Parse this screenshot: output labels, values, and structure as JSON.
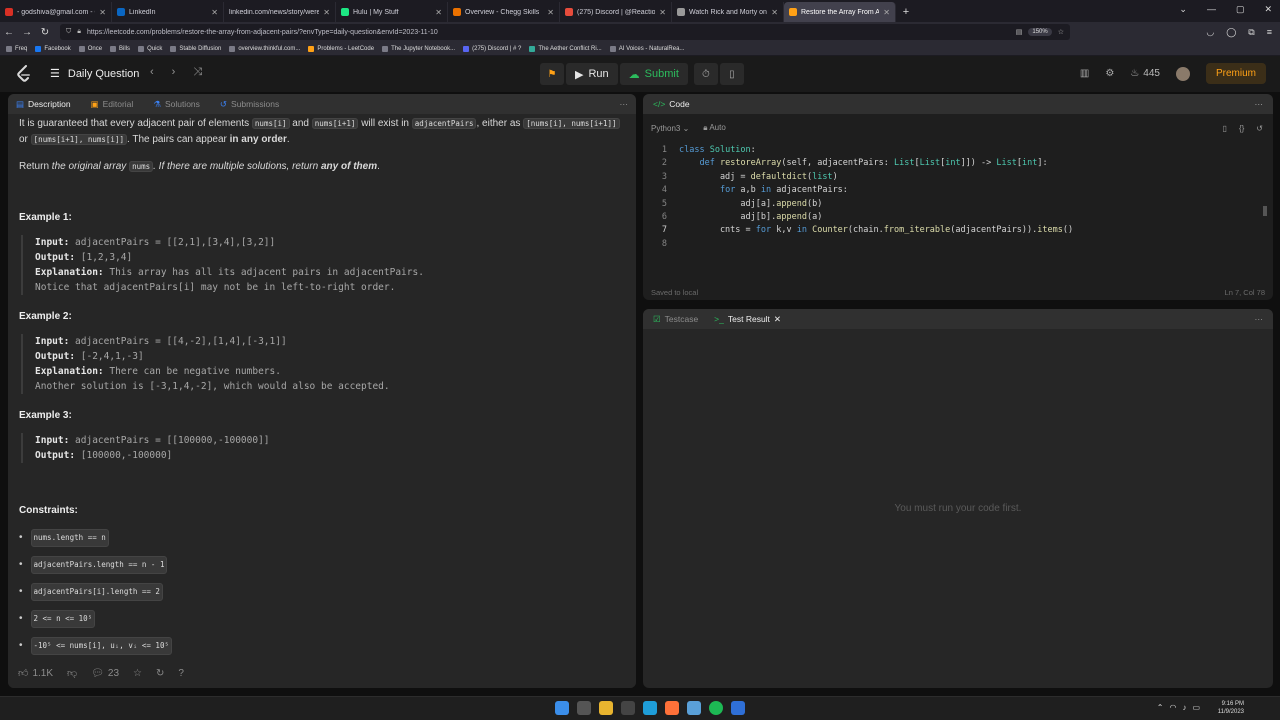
{
  "browser": {
    "tabs": [
      {
        "label": "- godshiva@gmail.com - Gmail",
        "color": "#d93025"
      },
      {
        "label": "LinkedIn",
        "color": "#0a66c2"
      },
      {
        "label": "linkedin.com/news/story/were-tipp",
        "color": "#777777"
      },
      {
        "label": "Hulu | My Stuff",
        "color": "#1ce783"
      },
      {
        "label": "Overview - Chegg Skills",
        "color": "#eb7100"
      },
      {
        "label": "(275) Discord | @Reaction Roles",
        "color": "#e74c3c"
      },
      {
        "label": "Watch Rick and Morty on Adult",
        "color": "#999999"
      },
      {
        "label": "Restore the Array From Adjacen",
        "color": "#ffa116",
        "active": true
      }
    ],
    "url": "https://leetcode.com/problems/restore-the-array-from-adjacent-pairs/?envType=daily-question&envId=2023-11-10",
    "zoom": "150%",
    "bookmarks": [
      "Freq",
      "Facebook",
      "Once",
      "Bills",
      "Quick",
      "Stable Diffusion",
      "overview.thinkful.com...",
      "Problems - LeetCode",
      "The Jupyter Notebook...",
      "(275) Discord | # ?",
      "The Aether Conflict Ri...",
      "AI Voices - NaturalRea..."
    ]
  },
  "header": {
    "daily_question": "Daily Question",
    "run": "Run",
    "submit": "Submit",
    "streak": "445",
    "premium": "Premium"
  },
  "left": {
    "tabs": [
      "Description",
      "Editorial",
      "Solutions",
      "Submissions"
    ],
    "para1": {
      "t1": "It is guaranteed that every adjacent pair of elements ",
      "c1": "nums[i]",
      "t2": " and ",
      "c2": "nums[i+1]",
      "t3": " will exist in ",
      "c3": "adjacentPairs",
      "t4": ", either as ",
      "c4": "[nums[i], nums[i+1]]",
      "t5": " or ",
      "c5": "[nums[i+1], nums[i]]",
      "t6": ". The pairs can appear ",
      "b1": "in any order",
      "t7": "."
    },
    "para2": {
      "t1": "Return ",
      "i1": "the original array ",
      "c1": "nums",
      "i2": ". If there are multiple solutions, return ",
      "b1": "any of them",
      "t2": "."
    },
    "examples": [
      {
        "title": "Example 1:",
        "input_label": "Input:",
        "input": " adjacentPairs = [[2,1],[3,4],[3,2]]",
        "output_label": "Output:",
        "output": " [1,2,3,4]",
        "expl_label": "Explanation:",
        "expl": " This array has all its adjacent pairs in adjacentPairs.",
        "expl2": "Notice that adjacentPairs[i] may not be in left-to-right order."
      },
      {
        "title": "Example 2:",
        "input_label": "Input:",
        "input": " adjacentPairs = [[4,-2],[1,4],[-3,1]]",
        "output_label": "Output:",
        "output": " [-2,4,1,-3]",
        "expl_label": "Explanation:",
        "expl": " There can be negative numbers.",
        "expl2": "Another solution is [-3,1,4,-2], which would also be accepted."
      },
      {
        "title": "Example 3:",
        "input_label": "Input:",
        "input": " adjacentPairs = [[100000,-100000]]",
        "output_label": "Output:",
        "output": " [100000,-100000]"
      }
    ],
    "constraints_title": "Constraints:",
    "constraints": [
      "nums.length == n",
      "adjacentPairs.length == n - 1",
      "adjacentPairs[i].length == 2",
      "2 <= n <= 10⁵",
      "-10⁵ <= nums[i], uᵢ, vᵢ <= 10⁵"
    ],
    "footer": {
      "likes": "1.1K",
      "comments": "23"
    }
  },
  "code": {
    "title": "Code",
    "language": "Python3",
    "mode": "Auto",
    "lines": [
      "1",
      "2",
      "3",
      "4",
      "5",
      "6",
      "7",
      "8"
    ],
    "status_left": "Saved to local",
    "status_right": "Ln 7, Col 78"
  },
  "test": {
    "tabs": [
      "Testcase",
      "Test Result"
    ],
    "empty": "You must run your code first."
  },
  "taskbar": {
    "time": "9:16 PM",
    "date": "11/9/2023"
  }
}
